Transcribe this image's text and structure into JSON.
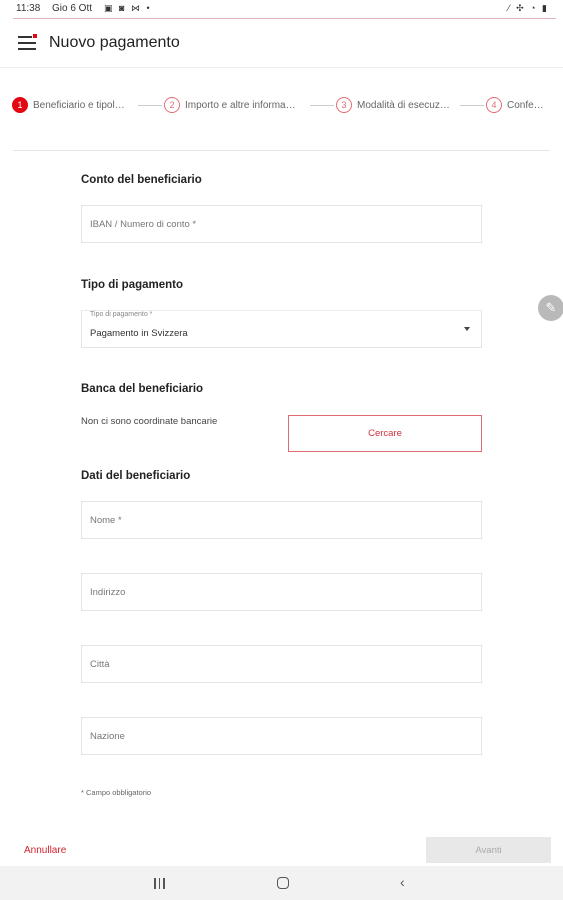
{
  "status_bar": {
    "time": "11:38",
    "date": "Gio 6 Ott",
    "notification_icons": "▣ ◙ ⋈ •",
    "system_icons": "⁄ ✣ ◔ ▮"
  },
  "app_bar": {
    "title": "Nuovo pagamento",
    "menu_icon": "hamburger-menu-icon"
  },
  "stepper": {
    "steps": [
      {
        "number": "1",
        "label": "Beneficiario e tipol…",
        "active": true
      },
      {
        "number": "2",
        "label": "Importo e altre informa…",
        "active": false
      },
      {
        "number": "3",
        "label": "Modalità di esecuz…",
        "active": false
      },
      {
        "number": "4",
        "label": "Confe…",
        "active": false
      }
    ]
  },
  "form": {
    "account_section_title": "Conto del beneficiario",
    "iban_placeholder": "IBAN / Numero di conto *",
    "payment_type_section_title": "Tipo di pagamento",
    "payment_type_label": "Tipo di pagamento *",
    "payment_type_value": "Pagamento in Svizzera",
    "bank_section_title": "Banca del beneficiario",
    "no_bank_text": "Non ci sono coordinate bancarie",
    "search_button": "Cercare",
    "beneficiary_section_title": "Dati del beneficiario",
    "name_placeholder": "Nome *",
    "address_placeholder": "Indirizzo",
    "city_placeholder": "Città",
    "country_placeholder": "Nazione",
    "required_note": "* Campo obbligatorio"
  },
  "actions": {
    "cancel": "Annullare",
    "next": "Avanti"
  },
  "colors": {
    "accent": "#e30613",
    "disabled_bg": "#e8e8e8"
  }
}
